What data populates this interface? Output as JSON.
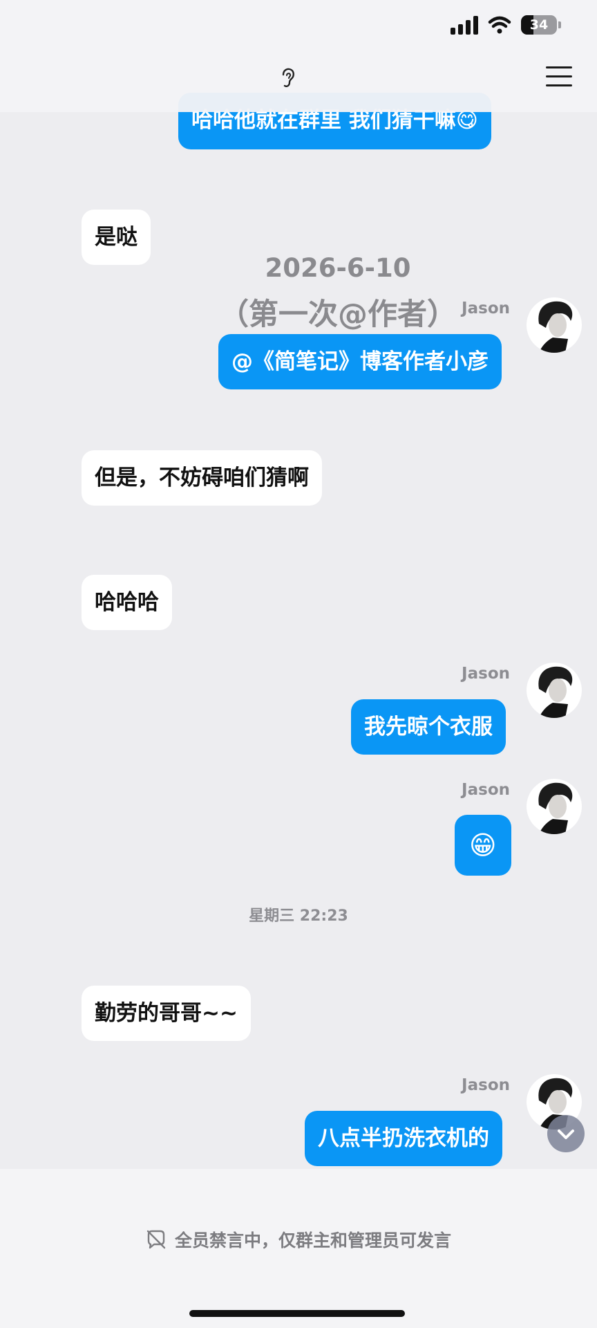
{
  "status_bar": {
    "battery_level": "34",
    "battery_fraction": 0.34
  },
  "header": {
    "ear_icon": "ear-icon",
    "menu_icon": "menu-icon"
  },
  "messages": [
    {
      "side": "out",
      "text": "哈哈他就在群里 我们猜干嘛😋"
    },
    {
      "side": "in",
      "text": "是哒"
    },
    {
      "side": "out",
      "sender": "Jason",
      "text": "@《简笔记》博客作者小彦"
    },
    {
      "side": "in",
      "text": "但是，不妨碍咱们猜啊"
    },
    {
      "side": "in",
      "text": "哈哈哈"
    },
    {
      "side": "out",
      "sender": "Jason",
      "text": "我先晾个衣服"
    },
    {
      "side": "out",
      "sender": "Jason",
      "text": "😁"
    },
    {
      "side": "in",
      "text": "勤劳的哥哥~~"
    },
    {
      "side": "out",
      "sender": "Jason",
      "text": "八点半扔洗衣机的"
    }
  ],
  "date_overlay": {
    "date": "2026-6-10",
    "note": "（第一次@作者）"
  },
  "time_separator": "星期三 22:23",
  "footer": {
    "mute_notice": "全员禁言中，仅群主和管理员可发言"
  },
  "colors": {
    "outgoing_bubble": "#0a96f5",
    "incoming_bubble": "#ffffff",
    "background": "#ededf0"
  }
}
